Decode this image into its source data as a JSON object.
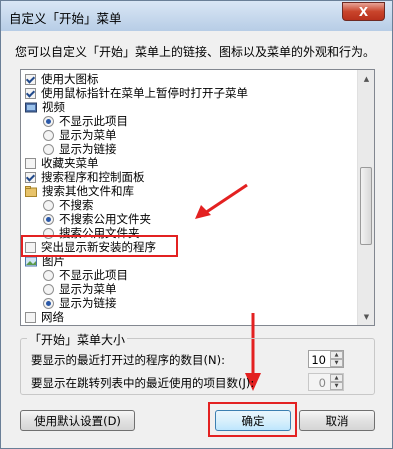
{
  "window": {
    "title": "自定义「开始」菜单",
    "close_glyph": "X"
  },
  "description": "您可以自定义「开始」菜单上的链接、图标以及菜单的外观和行为。",
  "options": {
    "large_icons": "使用大图标",
    "context_drag": "使用鼠标指针在菜单上暂停时打开子菜单",
    "videos": "视频",
    "videos_opt1": "不显示此项目",
    "videos_opt2": "显示为菜单",
    "videos_opt3": "显示为链接",
    "favorites": "收藏夹菜单",
    "search_programs": "搜索程序和控制面板",
    "search_other": "搜索其他文件和库",
    "search_opt1": "不搜索",
    "search_opt2": "不搜索公用文件夹",
    "search_opt3": "搜索公用文件夹",
    "highlight_new": "突出显示新安装的程序",
    "pictures": "图片",
    "pictures_opt1": "不显示此项目",
    "pictures_opt2": "显示为菜单",
    "pictures_opt3": "显示为链接",
    "network": "网络"
  },
  "size_group": {
    "title": "「开始」菜单大小",
    "recent_programs_label": "要显示的最近打开过的程序的数目(N):",
    "recent_programs_value": "10",
    "jumplist_label": "要显示在跳转列表中的最近使用的项目数(J):",
    "jumplist_value": "0"
  },
  "buttons": {
    "defaults": "使用默认设置(D)",
    "ok": "确定",
    "cancel": "取消"
  },
  "annotation_color": "#e32121"
}
